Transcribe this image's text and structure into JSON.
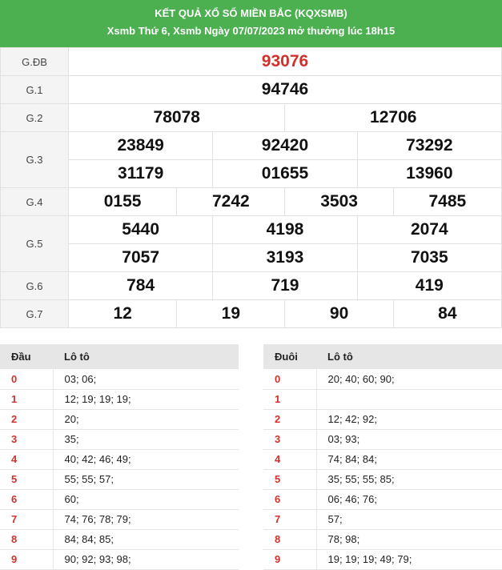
{
  "header": {
    "title": "KẾT QUẢ XỔ SỐ MIỀN BẮC (KQXSMB)",
    "subtitle": "Xsmb Thứ 6, Xsmb Ngày 07/07/2023 mở thưởng lúc 18h15"
  },
  "prizes": [
    {
      "label": "G.ĐB",
      "rows": [
        [
          "93076"
        ]
      ]
    },
    {
      "label": "G.1",
      "rows": [
        [
          "94746"
        ]
      ]
    },
    {
      "label": "G.2",
      "rows": [
        [
          "78078",
          "12706"
        ]
      ]
    },
    {
      "label": "G.3",
      "rows": [
        [
          "23849",
          "92420",
          "73292"
        ],
        [
          "31179",
          "01655",
          "13960"
        ]
      ]
    },
    {
      "label": "G.4",
      "rows": [
        [
          "0155",
          "7242",
          "3503",
          "7485"
        ]
      ]
    },
    {
      "label": "G.5",
      "rows": [
        [
          "5440",
          "4198",
          "2074"
        ],
        [
          "7057",
          "3193",
          "7035"
        ]
      ]
    },
    {
      "label": "G.6",
      "rows": [
        [
          "784",
          "719",
          "419"
        ]
      ]
    },
    {
      "label": "G.7",
      "rows": [
        [
          "12",
          "19",
          "90",
          "84"
        ]
      ]
    }
  ],
  "loto_head": {
    "col1": "Đầu",
    "col2": "Lô tô",
    "rows": [
      {
        "k": "0",
        "v": "03; 06;"
      },
      {
        "k": "1",
        "v": "12; 19; 19; 19;"
      },
      {
        "k": "2",
        "v": "20;"
      },
      {
        "k": "3",
        "v": "35;"
      },
      {
        "k": "4",
        "v": "40; 42; 46; 49;"
      },
      {
        "k": "5",
        "v": "55; 55; 57;"
      },
      {
        "k": "6",
        "v": "60;"
      },
      {
        "k": "7",
        "v": "74; 76; 78; 79;"
      },
      {
        "k": "8",
        "v": "84; 84; 85;"
      },
      {
        "k": "9",
        "v": "90; 92; 93; 98;"
      }
    ]
  },
  "loto_tail": {
    "col1": "Đuôi",
    "col2": "Lô tô",
    "rows": [
      {
        "k": "0",
        "v": "20; 40; 60; 90;"
      },
      {
        "k": "1",
        "v": ""
      },
      {
        "k": "2",
        "v": "12; 42; 92;"
      },
      {
        "k": "3",
        "v": "03; 93;"
      },
      {
        "k": "4",
        "v": "74; 84; 84;"
      },
      {
        "k": "5",
        "v": "35; 55; 55; 85;"
      },
      {
        "k": "6",
        "v": "06; 46; 76;"
      },
      {
        "k": "7",
        "v": "57;"
      },
      {
        "k": "8",
        "v": "78; 98;"
      },
      {
        "k": "9",
        "v": "19; 19; 19; 49; 79;"
      }
    ]
  }
}
